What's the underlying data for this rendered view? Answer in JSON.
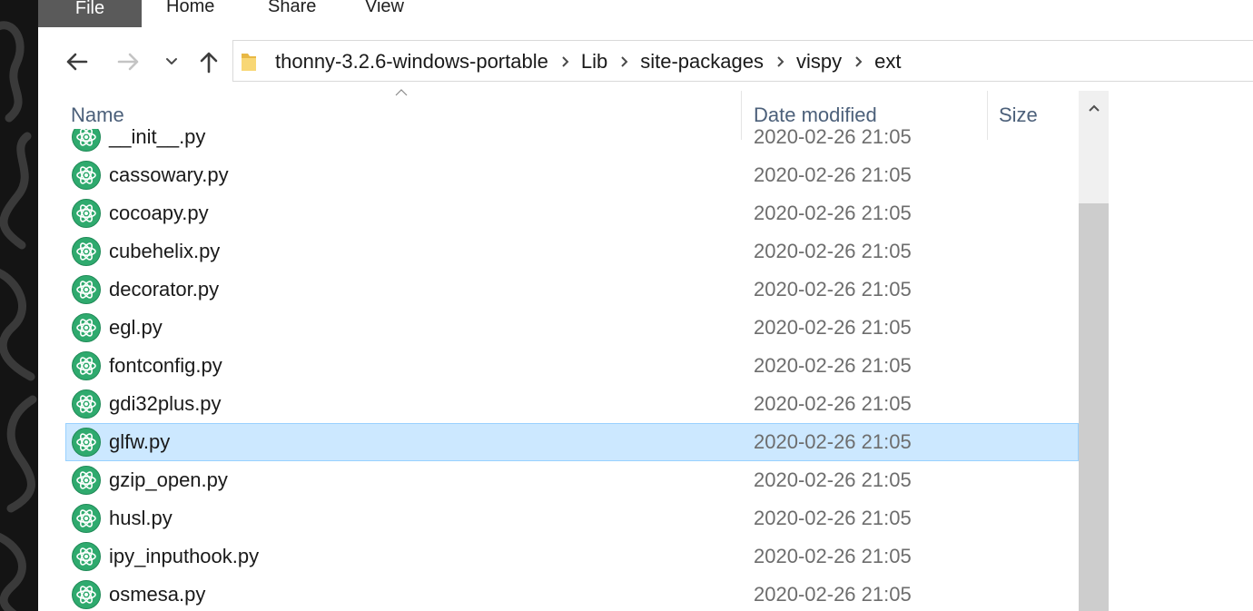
{
  "ribbon": {
    "tabs": [
      {
        "label": "File"
      },
      {
        "label": "Home"
      },
      {
        "label": "Share"
      },
      {
        "label": "View"
      }
    ]
  },
  "navigation": {
    "back_icon": "arrow-left-icon",
    "forward_icon": "arrow-right-icon",
    "recent_icon": "chevron-down-icon",
    "up_icon": "arrow-up-icon",
    "folder_icon": "folder-icon",
    "breadcrumbs": [
      "thonny-3.2.6-windows-portable",
      "Lib",
      "site-packages",
      "vispy",
      "ext"
    ]
  },
  "columns": {
    "name": "Name",
    "date_modified": "Date modified",
    "size": "Size"
  },
  "files": [
    {
      "name": "__init__.py",
      "date": "2020-02-26 21:05",
      "selected": false
    },
    {
      "name": "cassowary.py",
      "date": "2020-02-26 21:05",
      "selected": false
    },
    {
      "name": "cocoapy.py",
      "date": "2020-02-26 21:05",
      "selected": false
    },
    {
      "name": "cubehelix.py",
      "date": "2020-02-26 21:05",
      "selected": false
    },
    {
      "name": "decorator.py",
      "date": "2020-02-26 21:05",
      "selected": false
    },
    {
      "name": "egl.py",
      "date": "2020-02-26 21:05",
      "selected": false
    },
    {
      "name": "fontconfig.py",
      "date": "2020-02-26 21:05",
      "selected": false
    },
    {
      "name": "gdi32plus.py",
      "date": "2020-02-26 21:05",
      "selected": false
    },
    {
      "name": "glfw.py",
      "date": "2020-02-26 21:05",
      "selected": true
    },
    {
      "name": "gzip_open.py",
      "date": "2020-02-26 21:05",
      "selected": false
    },
    {
      "name": "husl.py",
      "date": "2020-02-26 21:05",
      "selected": false
    },
    {
      "name": "ipy_inputhook.py",
      "date": "2020-02-26 21:05",
      "selected": false
    },
    {
      "name": "osmesa.py",
      "date": "2020-02-26 21:05",
      "selected": false
    }
  ],
  "file_icon": "python-file-icon",
  "colors": {
    "selection": "#cce8ff",
    "file_tab": "#5a5a5a",
    "python_icon": "#2faa6e"
  }
}
